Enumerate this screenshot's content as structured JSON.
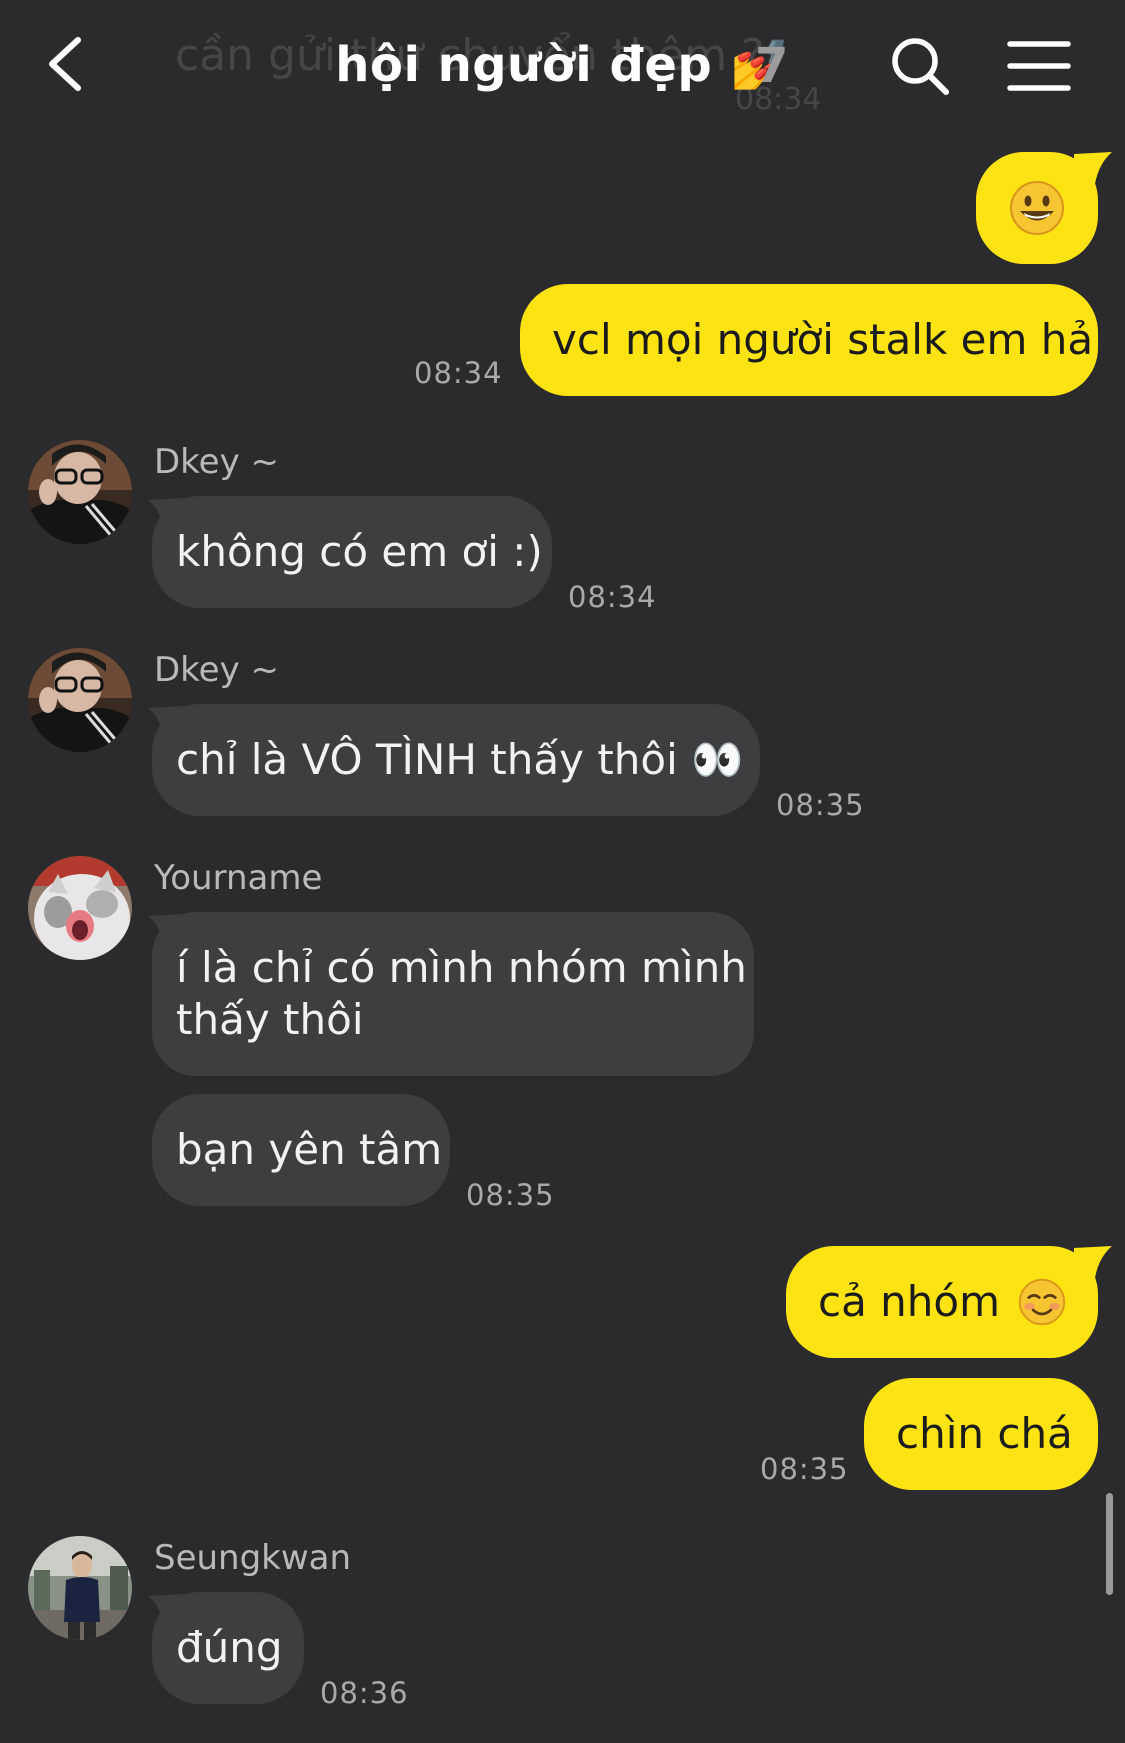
{
  "header": {
    "background_text": "cần gửi thư chuyển thêm ?",
    "background_time": "08:34",
    "title": "hội người đẹp 💅",
    "member_count": "7"
  },
  "messages": {
    "m1": "😀",
    "m2": "vcl mọi người stalk em hả",
    "t1": "08:34",
    "dkey_name_1": "Dkey ~",
    "m3": "không có em ơi :)",
    "t2": "08:34",
    "dkey_name_2": "Dkey ~",
    "m4": "chỉ là VÔ TÌNH thấy thôi 👀",
    "t3": "08:35",
    "yourname_name": "Yourname",
    "m5_line1": "í là chỉ có mình nhóm mình",
    "m5_line2": "thấy thôi",
    "m6": "bạn yên tâm",
    "t4": "08:35",
    "m7_text": "cả nhóm",
    "m7_emoji": "☺️",
    "m8": "chìn chá",
    "t5": "08:35",
    "seungkwan_name": "Seungkwan",
    "m9": "đúng",
    "t6": "08:36"
  },
  "colors": {
    "background": "#2b2b2d",
    "my_bubble": "#fde311",
    "their_bubble": "#3e3e40",
    "timestamp": "#a9a9a9",
    "sender_name": "#b9b9b9"
  }
}
